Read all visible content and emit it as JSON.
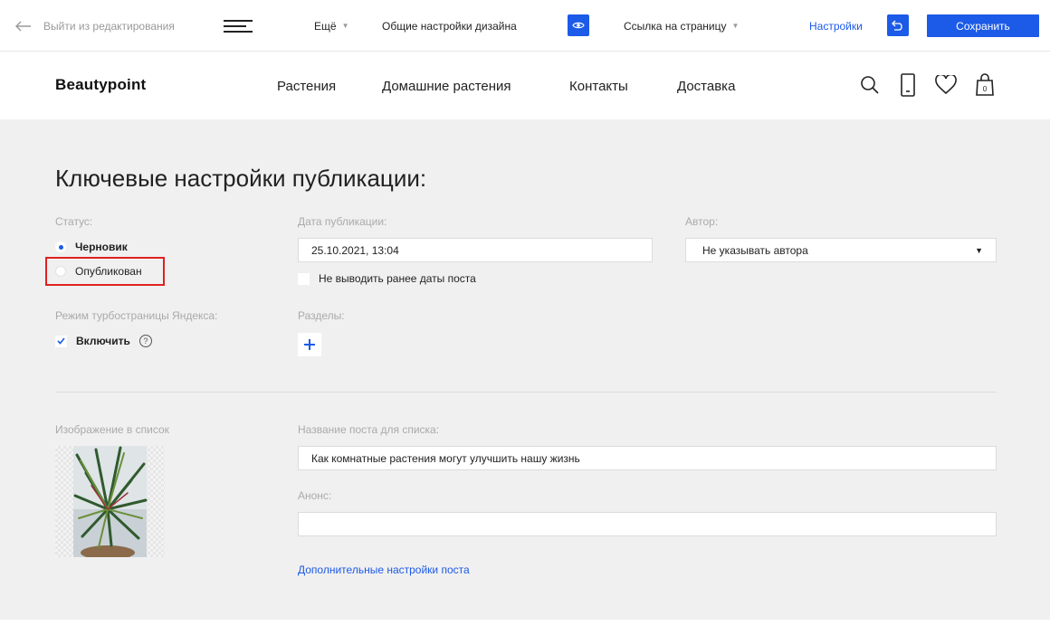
{
  "toolbar": {
    "exit_label": "Выйти из редактирования",
    "more_label": "Ещё",
    "design_label": "Общие настройки дизайна",
    "page_link_label": "Ссылка на страницу",
    "settings_label": "Настройки",
    "save_label": "Сохранить"
  },
  "header": {
    "logo": "Beautypoint",
    "nav": [
      "Растения",
      "Домашние растения",
      "Контакты",
      "Доставка"
    ]
  },
  "main": {
    "title": "Ключевые настройки публикации:",
    "status": {
      "label": "Статус:",
      "options": [
        {
          "label": "Черновик",
          "selected": true
        },
        {
          "label": "Опубликован",
          "selected": false
        }
      ]
    },
    "publish_date": {
      "label": "Дата публикации:",
      "value": "25.10.2021, 13:04",
      "hide_before_label": "Не выводить ранее даты поста",
      "hide_before_checked": false
    },
    "author": {
      "label": "Автор:",
      "value": "Не указывать автора"
    },
    "turbo": {
      "label": "Режим турбостраницы Яндекса:",
      "enable_label": "Включить",
      "checked": true,
      "help_glyph": "?"
    },
    "sections": {
      "label": "Разделы:",
      "add_glyph": "+"
    },
    "list_image_label": "Изображение в список",
    "list_title": {
      "label": "Название поста для списка:",
      "value": "Как комнатные растения могут улучшить нашу жизнь"
    },
    "announce": {
      "label": "Анонс:",
      "value": ""
    },
    "extra_link": "Дополнительные настройки поста"
  },
  "colors": {
    "accent": "#1c5ae8",
    "highlight": "#e02020",
    "background": "#f0f0f0"
  },
  "icons": [
    "arrow-left-icon",
    "hamburger-icon",
    "eye-icon",
    "undo-icon",
    "search-icon",
    "phone-icon",
    "heart-icon",
    "shopping-bag-icon",
    "help-icon",
    "plus-icon",
    "check-icon"
  ]
}
